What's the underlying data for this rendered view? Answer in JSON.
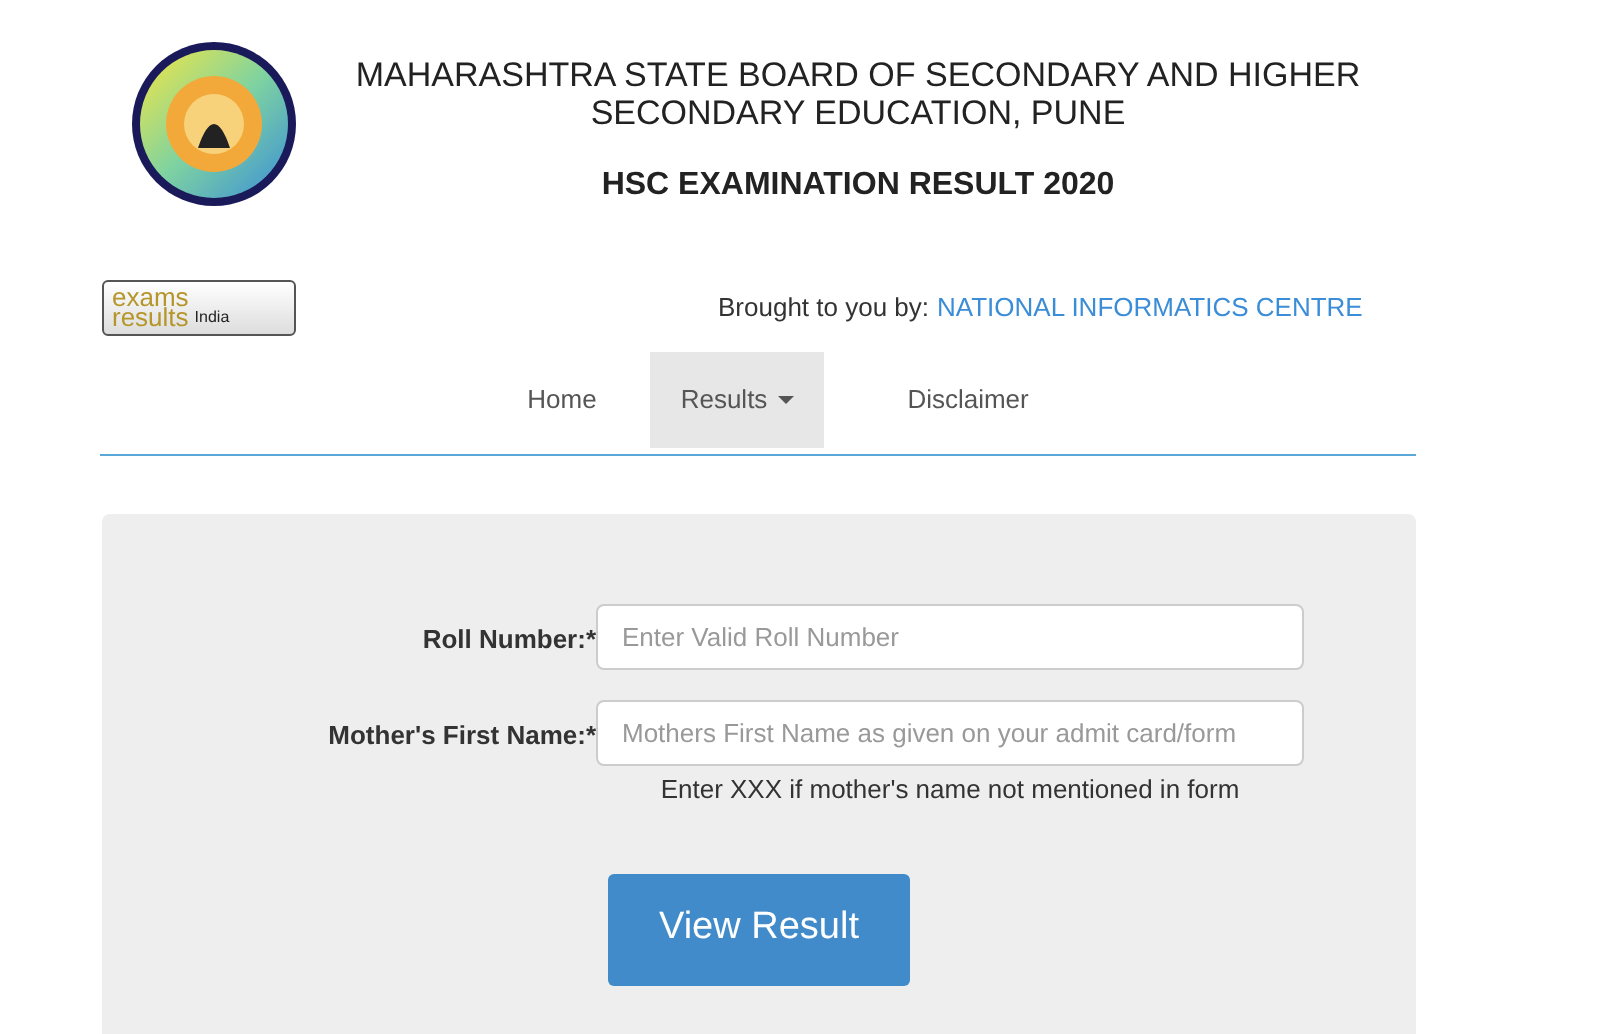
{
  "header": {
    "title": "MAHARASHTRA STATE BOARD OF SECONDARY AND HIGHER SECONDARY EDUCATION, PUNE",
    "subtitle": "HSC EXAMINATION RESULT 2020"
  },
  "partner_logo": {
    "line_1": "exams",
    "line_2": "results",
    "line_3": "India"
  },
  "credit": {
    "label": "Brought to you by:",
    "link": "NATIONAL INFORMATICS CENTRE"
  },
  "nav": [
    {
      "label": "Home",
      "selected": false,
      "dropdown": false
    },
    {
      "label": "Results",
      "selected": true,
      "dropdown": true
    },
    {
      "label": "Disclaimer",
      "selected": false,
      "dropdown": false
    }
  ],
  "form": {
    "fields": [
      {
        "label": "Roll Number:*",
        "placeholder": "Enter Valid Roll Number"
      },
      {
        "label": "Mother's First Name:*",
        "placeholder": "Mothers First Name as given on your admit card/form",
        "help": "Enter XXX if mother's name not mentioned in form"
      }
    ],
    "submit": "View Result"
  }
}
